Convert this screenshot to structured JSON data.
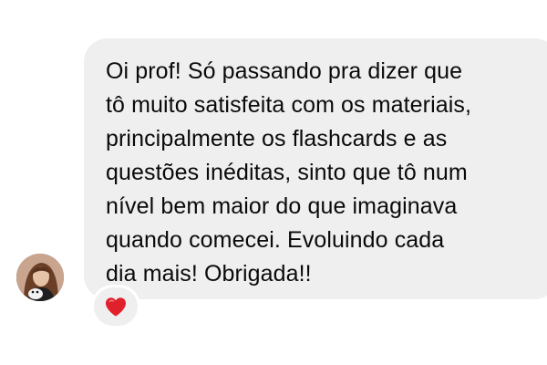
{
  "message": {
    "lines": [
      "Oi prof! Só passando pra dizer que",
      "tô muito satisfeita com os materiais,",
      "principalmente os flashcards e as",
      "questões inéditas, sinto que tô num",
      "nível bem maior do que imaginava",
      "quando comecei. Evoluindo cada",
      "dia mais! Obrigada!!"
    ]
  },
  "reaction": {
    "icon": "heart-icon",
    "color": "#e0202a"
  },
  "colors": {
    "bubble": "#efefef",
    "text": "#0a0a0a",
    "background": "#ffffff"
  }
}
